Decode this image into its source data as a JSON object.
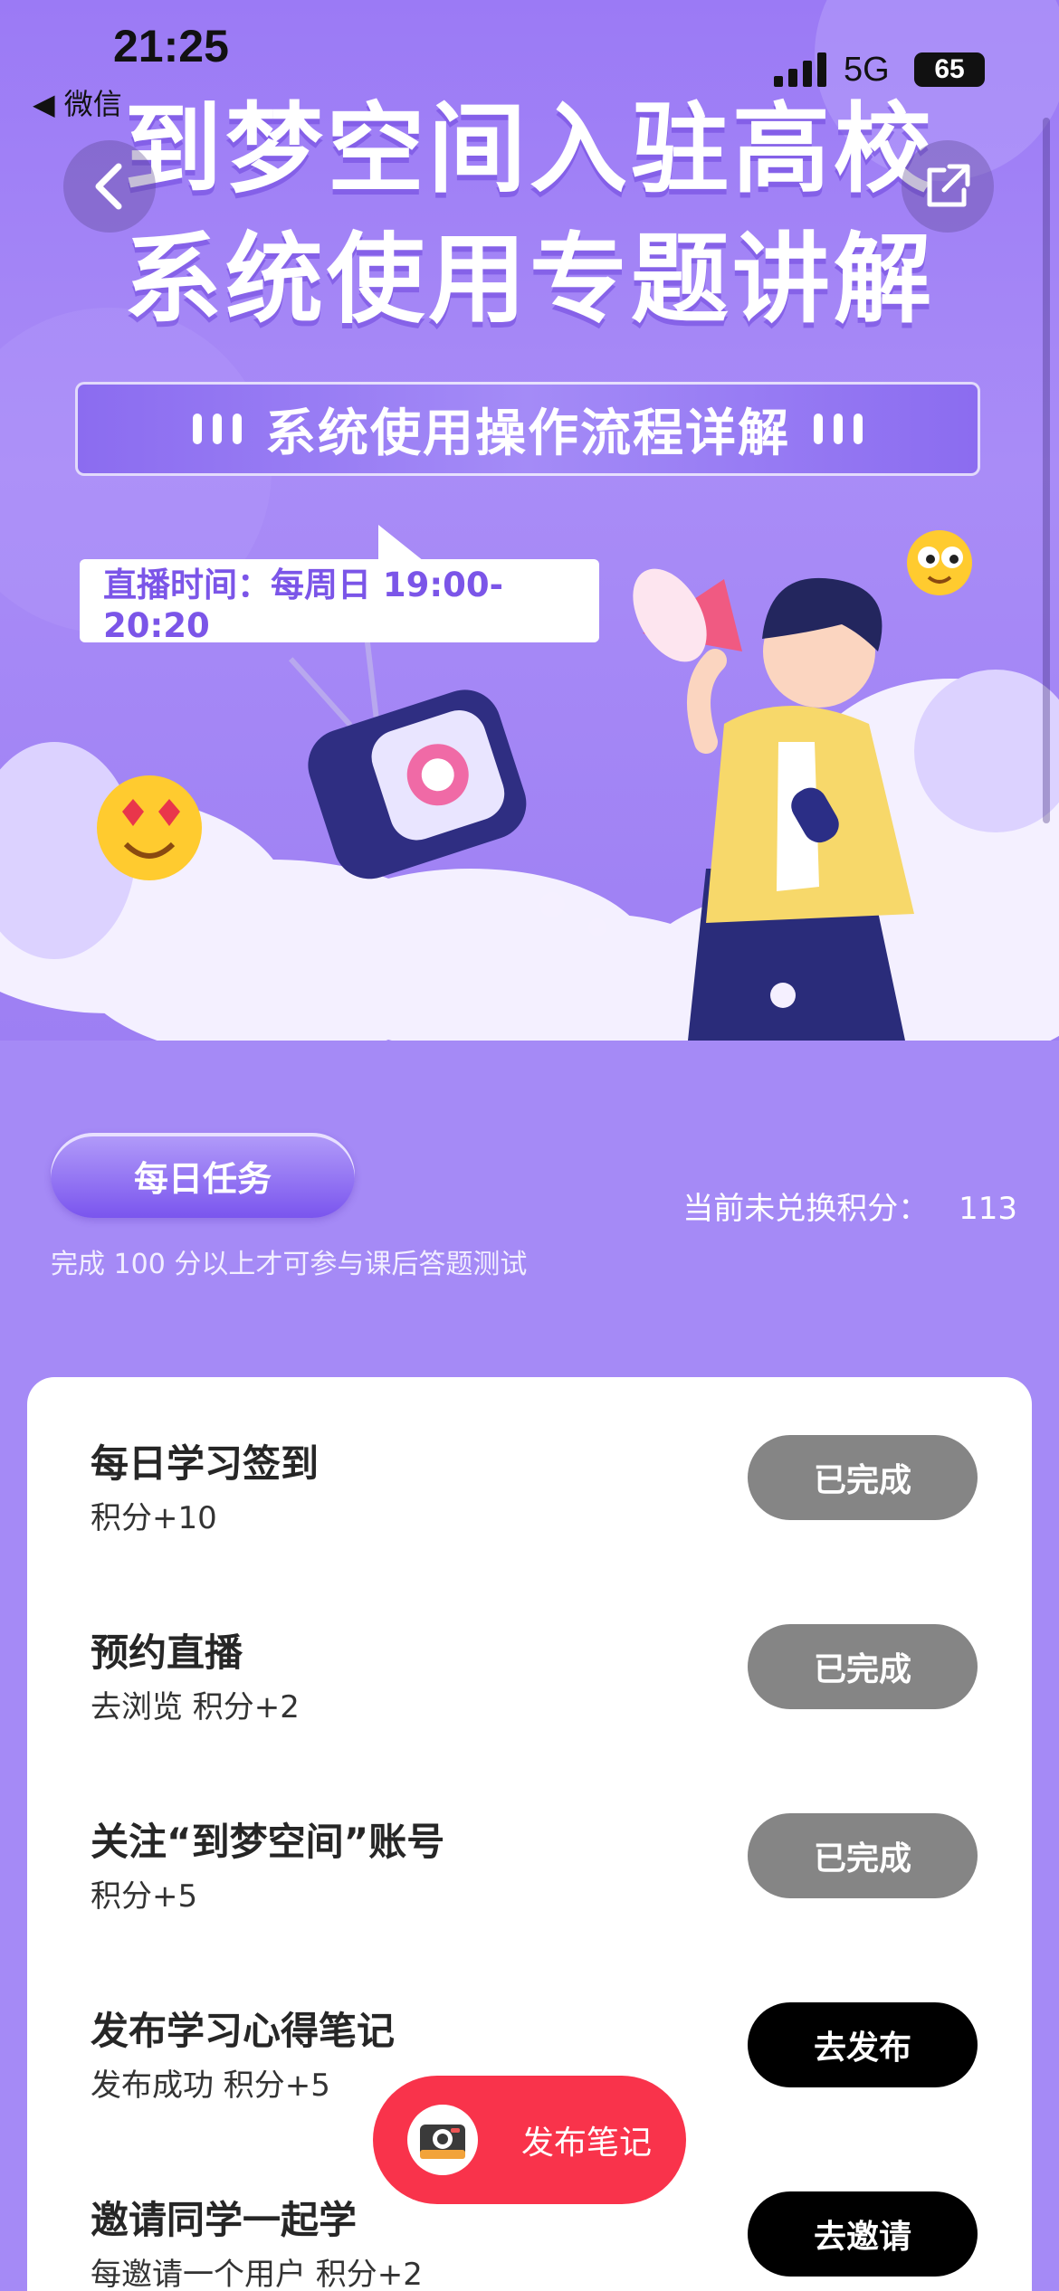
{
  "status_bar": {
    "time": "21:25",
    "back_app": "◀ 微信",
    "network": "5G",
    "battery": "65"
  },
  "hero": {
    "title_line1": "到梦空间入驻高校",
    "title_line2": "系统使用专题讲解",
    "subtitle": "系统使用操作流程详解",
    "live_time": "直播时间：每周日 19:00-20:20"
  },
  "points": {
    "daily_tasks_label": "每日任务",
    "unredeemed_label": "当前未兑换积分：",
    "unredeemed_value": "113",
    "hint": "完成 100 分以上才可参与课后答题测试"
  },
  "tasks": [
    {
      "title": "每日学习签到",
      "sub": "积分+10",
      "button": "已完成",
      "state": "done"
    },
    {
      "title": "预约直播",
      "sub": "去浏览 积分+2",
      "button": "已完成",
      "state": "done"
    },
    {
      "title": "关注“到梦空间”账号",
      "sub": "积分+5",
      "button": "已完成",
      "state": "done"
    },
    {
      "title": "发布学习心得笔记",
      "sub": "发布成功 积分+5",
      "button": "去发布",
      "state": "todo"
    },
    {
      "title": "邀请同学一起学",
      "sub": "每邀请一个用户 积分+2",
      "button": "去邀请",
      "state": "todo"
    }
  ],
  "fab": {
    "label": "发布笔记"
  },
  "colors": {
    "page_bg": "#a58af6",
    "done_button": "#858585",
    "action_button": "#000000",
    "fab": "#f9334b",
    "live_text": "#7b55e8"
  }
}
